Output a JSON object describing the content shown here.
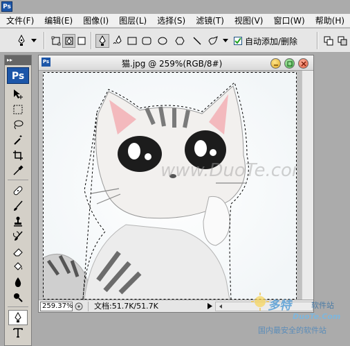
{
  "app": {
    "logo": "Ps"
  },
  "menu": [
    {
      "label": "文件(F)"
    },
    {
      "label": "编辑(E)"
    },
    {
      "label": "图像(I)"
    },
    {
      "label": "图层(L)"
    },
    {
      "label": "选择(S)"
    },
    {
      "label": "滤镜(T)"
    },
    {
      "label": "视图(V)"
    },
    {
      "label": "窗口(W)"
    },
    {
      "label": "帮助(H)"
    }
  ],
  "options": {
    "auto_add_delete": {
      "label": "自动添加/删除",
      "checked": true
    }
  },
  "toolbox": {
    "logo": "Ps",
    "tools": [
      "move-tool",
      "marquee-tool",
      "lasso-tool",
      "magic-wand-tool",
      "crop-tool",
      "eyedropper-tool",
      "healing-brush-tool",
      "brush-tool",
      "clone-stamp-tool",
      "history-brush-tool",
      "eraser-tool",
      "paint-bucket-tool",
      "blur-tool",
      "dodge-tool",
      "pen-tool",
      "type-tool"
    ],
    "active_tool": "pen-tool"
  },
  "document": {
    "title": "猫.jpg @ 259%(RGB/8#)",
    "zoom": "259.37%",
    "doc_size": "文档:51.7K/51.7K",
    "canvas_watermark": "www.DuoTe.com"
  },
  "watermark": {
    "logo": "多特",
    "sub": "软件站",
    "domain": "DuoTe.Com",
    "slogan": "国内最安全的软件站"
  },
  "colors": {
    "ps_blue": "#1d56a8",
    "close_red": "#e05a3a",
    "minimize_yellow": "#e0a823",
    "maximize_green": "#46b24a"
  }
}
